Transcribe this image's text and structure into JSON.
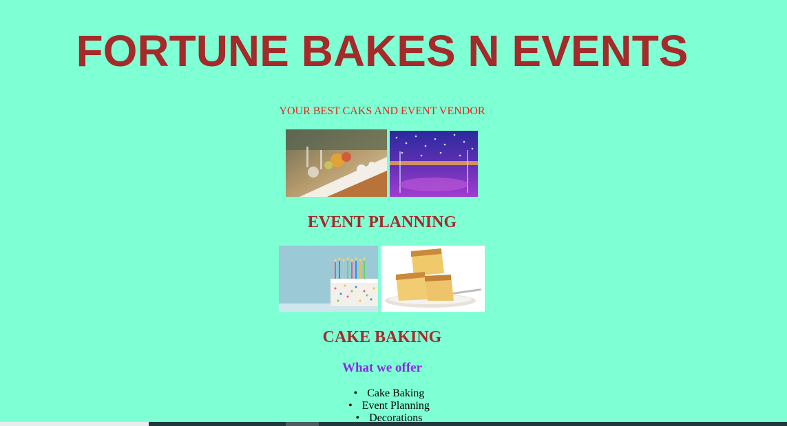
{
  "header": {
    "title": "FORTUNE BAKES N EVENTS",
    "tagline": "YOUR BEST CAKS AND EVENT VENDOR"
  },
  "events": {
    "heading": "EVENT PLANNING",
    "images": [
      "banquet-table-photo",
      "lit-venue-photo"
    ]
  },
  "cakes": {
    "heading": "CAKE BAKING",
    "images": [
      "birthday-cake-photo",
      "sponge-cake-photo"
    ]
  },
  "offer": {
    "heading": "What we offer",
    "items": [
      "Cake Baking",
      "Event Planning",
      "Decorations"
    ]
  },
  "colors": {
    "background": "#7fffd4",
    "title": "#a52a2a",
    "tagline": "#e8251b",
    "offer_heading": "#8a2be2"
  }
}
